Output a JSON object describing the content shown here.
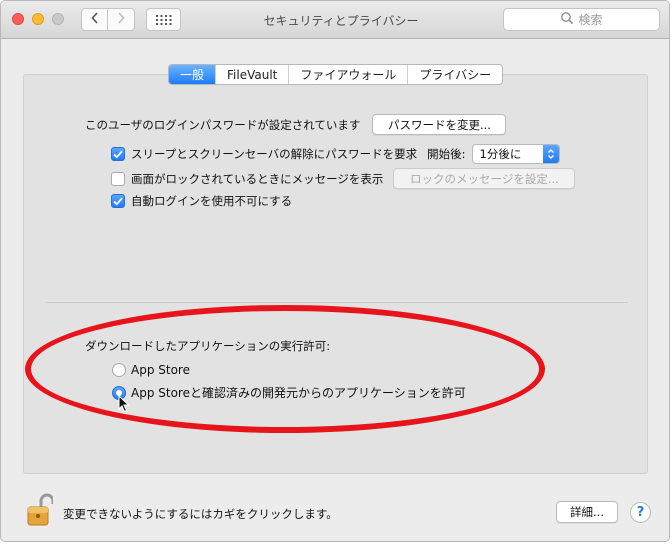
{
  "window": {
    "title": "セキュリティとプライバシー",
    "search_placeholder": "検索"
  },
  "tabs": [
    {
      "label": "一般",
      "active": true
    },
    {
      "label": "FileVault",
      "active": false
    },
    {
      "label": "ファイアウォール",
      "active": false
    },
    {
      "label": "プライバシー",
      "active": false
    }
  ],
  "general": {
    "password_set_label": "このユーザのログインパスワードが設定されています",
    "change_password_button": "パスワードを変更...",
    "require_password": {
      "label": "スリープとスクリーンセーバの解除にパスワードを要求",
      "checked": true
    },
    "start_label": "開始後:",
    "start_value": "1分後に",
    "show_message": {
      "label": "画面がロックされているときにメッセージを表示",
      "checked": false
    },
    "set_message_button": "ロックのメッセージを設定...",
    "disable_auto_login": {
      "label": "自動ログインを使用不可にする",
      "checked": true
    }
  },
  "downloads": {
    "heading": "ダウンロードしたアプリケーションの実行許可:",
    "options": [
      {
        "label": "App Store",
        "selected": false
      },
      {
        "label": "App Storeと確認済みの開発元からのアプリケーションを許可",
        "selected": true
      }
    ]
  },
  "footer": {
    "lock_text": "変更できないようにするにはカギをクリックします。",
    "details_button": "詳細...",
    "help_label": "?"
  },
  "colors": {
    "accent": "#2479f2",
    "annotation": "#e8141b"
  }
}
